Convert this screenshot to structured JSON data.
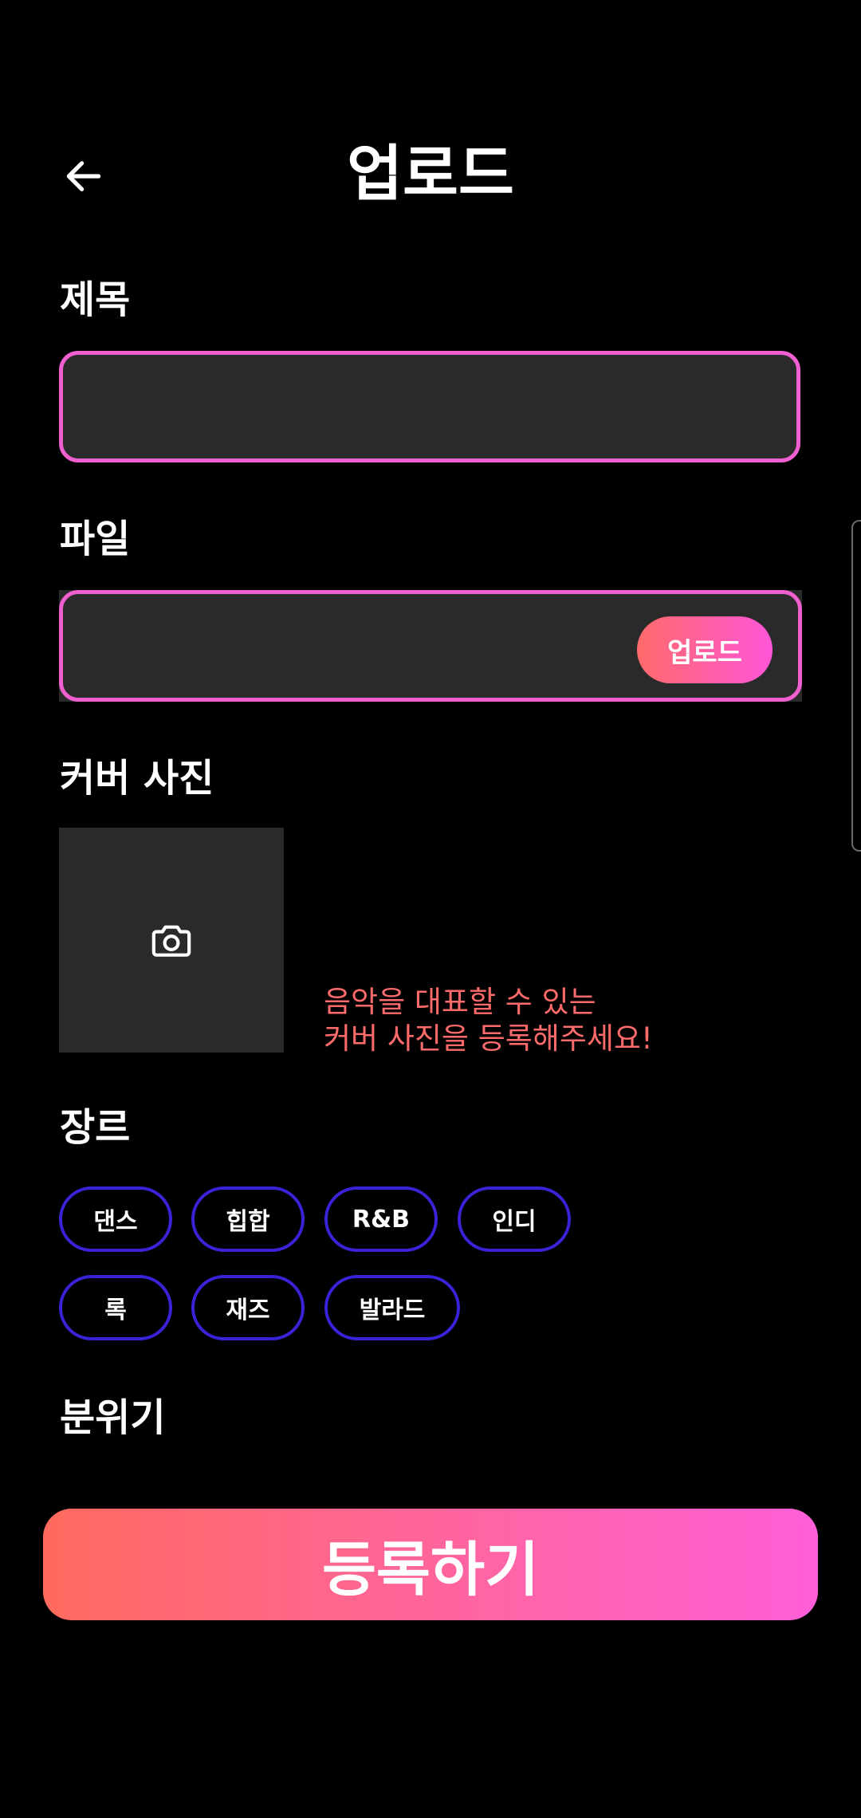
{
  "header": {
    "back_icon": "arrow-left-icon",
    "title": "업로드"
  },
  "form": {
    "title_label": "제목",
    "title_value": "",
    "file_label": "파일",
    "file_value": "",
    "upload_button": "업로드",
    "cover_label": "커버 사진",
    "cover_icon": "camera-icon",
    "cover_hint_line1": "음악을 대표할 수 있는",
    "cover_hint_line2": "커버 사진을 등록해주세요!",
    "genre_label": "장르",
    "genres": [
      "댄스",
      "힙합",
      "R&B",
      "인디",
      "록",
      "재즈",
      "발라드"
    ],
    "mood_label": "분위기"
  },
  "submit_button": "등록하기",
  "colors": {
    "background": "#000000",
    "field_background": "#2a2a2a",
    "field_border": "#ef5fd0",
    "chip_border": "#3a22d6",
    "hint_text": "#ff6b6b",
    "gradient_start": "#ff6a5e",
    "gradient_end": "#ff5fd8"
  }
}
